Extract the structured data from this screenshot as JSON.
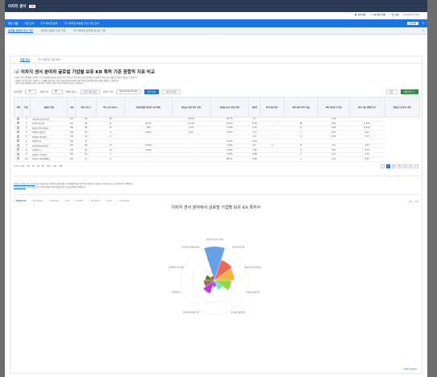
{
  "app": {
    "brand": "이지지 센서",
    "tag": "EN"
  },
  "utility": [
    "사이트맵",
    "나의 관심 목록",
    "로그아웃",
    "powered by 특허"
  ],
  "nav1": {
    "items": [
      "주요 기업",
      "기업 검색",
      "국가 특허권 분석",
      "국가 특허권 특허권 주관 기관 검색"
    ],
    "active": 0,
    "lang": "한국어"
  },
  "nav2": {
    "items": [
      "글로벌 관점의 주요 기업",
      "한국내 관점의 주요 기업",
      "국가 특허권 한국에 유사한 기업"
    ],
    "active": 0,
    "close": "×"
  },
  "grip": "· · ·",
  "tabs": {
    "items": [
      "종합 비교",
      "국가 특허권 신청 입력"
    ],
    "active": 0
  },
  "title": "이차지 센서 분야의 글로벌 기업별 보유 KR 특허 기준 종합적 지표 비교",
  "notes": [
    "· 이차지 센서 분야에서 보유하는 국가 특허권의 성과를 글로벌 기업 기준으로 비교하여 조사한 결과를 나타냅니다. 특허 보유 현황 및 등록 추이를 볼 수 있습니다.",
    "· 기업별 보유 특허 건수, 피인용 수, 등록률, 특허 점수 등의 지표를 함께 제공하며 표의 항목을 클릭하면 정렬 기준을 변경할 수 있습니다.",
    "· 검색 조건을 변경하면 결과가 갱신되며, 선택한 기업은 아래 차트에서 비교할 수 있습니다."
  ],
  "filters": {
    "label_period": "검색 범위",
    "period": "20",
    "period_unit": "인용 시작",
    "country": "KR",
    "label_type": "이벤트(필드)",
    "type": "기업 기준 선정",
    "label_region": "출원국 국적",
    "region": "KR (South Korea)",
    "search": "검색 적용",
    "reset": "검색 초기화",
    "view": "단위",
    "excel": "엑셀다운로드"
  },
  "table": {
    "headers": [
      "선택",
      "번호",
      "출원인 이름",
      "국적",
      "특허 보유 수",
      "특허 신규 등록 수",
      "인용성장률 (피인용 1년 대비)",
      "점유율 (보유 특허 기준)",
      "점유율 (신규 등록 기준)",
      "집중성",
      "특허 평균 점수",
      "특허 상위 10% 비율",
      "특허 피인용 수 평균",
      "특허 기술 영향력 지수",
      "점유율 (국 특허 기준)"
    ],
    "rows": [
      [
        "1",
        "국내 센서 분야 A기업",
        "KR",
        "44",
        "46",
        "-",
        "0.41%",
        "39.7%",
        "1.7",
        "-",
        "-",
        "0.16",
        "-"
      ],
      [
        "2",
        "한국전기연구원",
        "KR",
        "28",
        "21",
        "25.4%",
        "0.13%",
        "0.57%",
        "5.38",
        "-",
        "28",
        "0.62",
        "0.15%"
      ],
      [
        "3",
        "엘지이노텍 주식회사",
        "KR",
        "26",
        "17",
        "19%",
        "0.1%",
        "1.13%",
        "2.75",
        "-",
        "17",
        "0.65",
        "0.11%"
      ],
      [
        "4",
        "LG에너지솔루션",
        "KR",
        "22",
        "8",
        "6.91%",
        "0.1%",
        "0.07%",
        "2.71",
        "-",
        "1",
        "0.03",
        "0.01"
      ],
      [
        "5",
        "주식회사 엘지화학",
        "KR",
        "13",
        "6",
        "-",
        "-",
        "-",
        "2.5",
        "-",
        "2",
        "0.21",
        "0.5"
      ],
      [
        "6",
        "현대자동차",
        "KR",
        "8",
        "-",
        "-",
        "-",
        "21.2%",
        "2.79",
        "-",
        "-",
        "-",
        "-"
      ],
      [
        "7",
        "한국전자통신연구원",
        "KR",
        "18",
        "13",
        "0.29%",
        "-",
        "1.29%",
        "3.3",
        "1",
        "6",
        "0.3",
        "0.12"
      ],
      [
        "8",
        "한양대학교",
        "KR",
        "14",
        "13",
        "16.9%",
        "-",
        "2.06%",
        "3.41",
        "-",
        "6",
        "0.63",
        "0.19"
      ],
      [
        "9",
        "삼성전자 주식회사",
        "KR",
        "12",
        "3",
        "-",
        "-",
        "3.47%",
        "5.86",
        "-",
        "3",
        "0.27",
        "0.76"
      ],
      [
        "10",
        "주식회사 에이치피에스",
        "KR",
        "6",
        "8",
        "-",
        "-",
        "86.3%",
        "3.89",
        "-",
        "1",
        "0.11",
        "0.67"
      ]
    ]
  },
  "pager": {
    "summary": "총 10 / 전체",
    "sizes": [
      "10",
      "20",
      "30",
      "50",
      "100",
      "200",
      "500"
    ],
    "pages": [
      "‹",
      "1",
      "2",
      "3",
      "4",
      "5",
      "›"
    ],
    "active": "1"
  },
  "footnotes": [
    {
      "link": "신청은 (a) 특허 (b) count",
      "text": " 지표 기준을 지금 분야에서 선정 대상으로 변경하면 해당 기업 중심 내용이 표시됩니다. 특허 점수 표시는 평균 점수 기준입니다."
    },
    {
      "link": "점유율 (a) 특허",
      "text": " 지표 기준을 한국 국적 분야에서 특허 점유율 계산식 산출 결과를 이용합니다."
    }
  ],
  "charttabs": {
    "items": [
      "Windrose",
      "2D Matrix",
      "Treemap",
      "Bar",
      "Scatter",
      "3D Matrix",
      "Polar",
      "2D Scatter"
    ],
    "active": 0,
    "right": [
      "확대",
      "인쇄"
    ]
  },
  "chart_data": {
    "type": "windrose",
    "title": "이차지 센서 분야에서 글로벌 기업별 보유 KR 특허수",
    "categories": [
      "국내 센서 분야 A기업",
      "한국전기연구원",
      "엘지이노텍 주식회사",
      "LG에너지솔루션",
      "주식회사 엘지화학",
      "현대자동차",
      "한국전자통신연구원",
      "한양대학교",
      "삼성전자 주식회사",
      "주식회사 에이치피에스"
    ],
    "values": [
      44,
      28,
      26,
      22,
      13,
      8,
      18,
      14,
      12,
      6
    ],
    "colors": [
      "#4a90e2",
      "#e94e3c",
      "#f5a623",
      "#7ed321",
      "#50e3c2",
      "#9013fe",
      "#bd10e0",
      "#8b572a",
      "#417505",
      "#d0021b"
    ]
  },
  "credit": "Data Flagship"
}
